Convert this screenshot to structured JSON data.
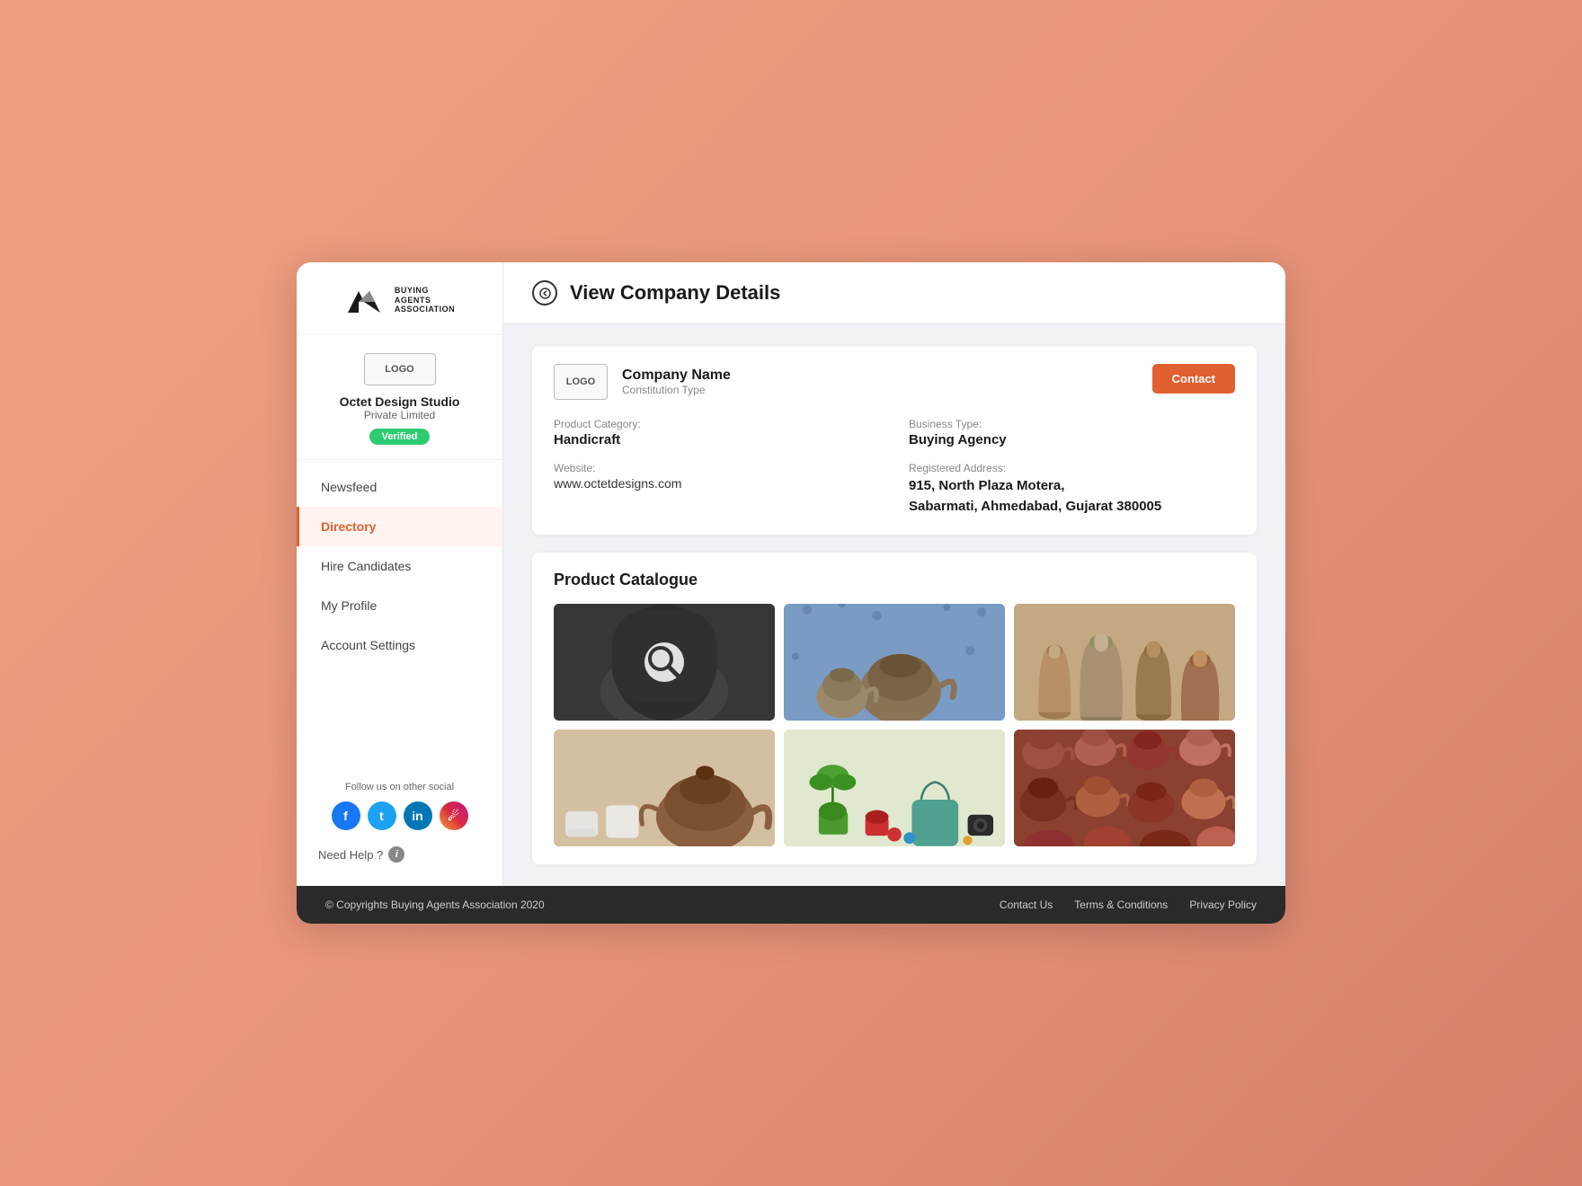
{
  "logo": {
    "brand_name_line1": "BUYING",
    "brand_name_line2": "AGENTS",
    "brand_name_line3": "ASSOCIATION"
  },
  "sidebar": {
    "company_logo_label": "LOGO",
    "company_name": "Octet Design Studio",
    "company_type": "Private Limited",
    "verified_label": "Verified",
    "nav_items": [
      {
        "id": "newsfeed",
        "label": "Newsfeed",
        "active": false
      },
      {
        "id": "directory",
        "label": "Directory",
        "active": true
      },
      {
        "id": "hire-candidates",
        "label": "Hire Candidates",
        "active": false
      },
      {
        "id": "my-profile",
        "label": "My Profile",
        "active": false
      },
      {
        "id": "account-settings",
        "label": "Account Settings",
        "active": false
      }
    ],
    "social_label": "Follow us on other social",
    "need_help_label": "Need Help ?"
  },
  "page_header": {
    "back_icon": "←",
    "title": "View Company Details"
  },
  "company": {
    "logo_label": "LOGO",
    "name": "Company Name",
    "constitution": "Constitution Type",
    "contact_button": "Contact",
    "product_category_label": "Product Category:",
    "product_category": "Handicraft",
    "business_type_label": "Business Type:",
    "business_type": "Buying Agency",
    "website_label": "Website:",
    "website": "www.octetdesigns.com",
    "address_label": "Registered Address:",
    "address_line1": "915, North Plaza Motera,",
    "address_line2": "Sabarmati, Ahmedabad, Gujarat 380005"
  },
  "catalogue": {
    "title": "Product Catalogue",
    "images": [
      {
        "id": "thumb-1",
        "class": "thumb-1",
        "has_overlay": true,
        "alt": "pottery item 1"
      },
      {
        "id": "thumb-2",
        "class": "thumb-2",
        "has_overlay": false,
        "alt": "teapots on floral"
      },
      {
        "id": "thumb-3",
        "class": "thumb-3",
        "has_overlay": false,
        "alt": "clay vases"
      },
      {
        "id": "thumb-4",
        "class": "thumb-4",
        "has_overlay": false,
        "alt": "tea set"
      },
      {
        "id": "thumb-5",
        "class": "thumb-5",
        "has_overlay": false,
        "alt": "plants and accessories"
      },
      {
        "id": "thumb-6",
        "class": "thumb-6",
        "has_overlay": false,
        "alt": "brown teapots collection"
      }
    ]
  },
  "footer": {
    "copyright": "© Copyrights Buying Agents Association 2020",
    "links": [
      {
        "id": "contact-us",
        "label": "Contact Us"
      },
      {
        "id": "terms",
        "label": "Terms & Conditions"
      },
      {
        "id": "privacy",
        "label": "Privacy Policy"
      }
    ]
  }
}
